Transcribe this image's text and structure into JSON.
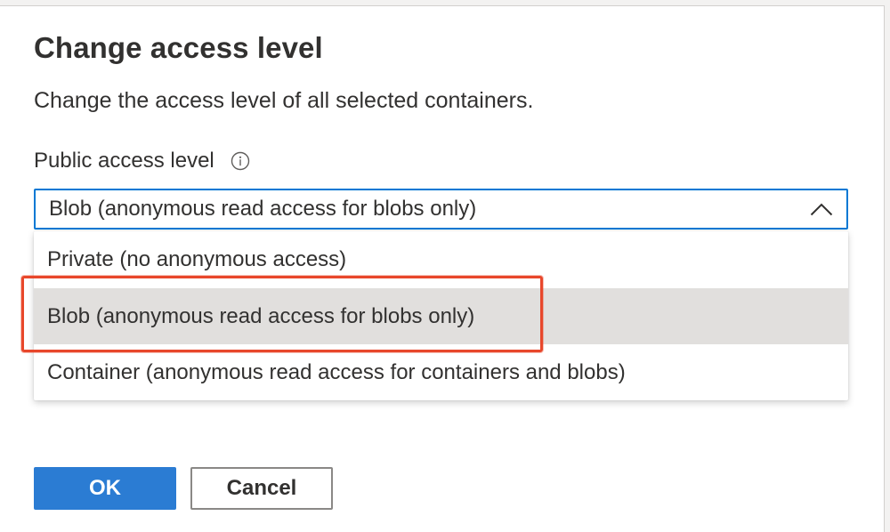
{
  "dialog": {
    "title": "Change access level",
    "description": "Change the access level of all selected containers."
  },
  "field": {
    "label": "Public access level",
    "info_icon": "info-icon",
    "selected_value": "Blob (anonymous read access for blobs only)",
    "chevron_icon": "chevron-up-icon",
    "options": [
      {
        "label": "Private (no anonymous access)",
        "selected": false
      },
      {
        "label": "Blob (anonymous read access for blobs only)",
        "selected": true
      },
      {
        "label": "Container (anonymous read access for containers and blobs)",
        "selected": false
      }
    ]
  },
  "annotation": {
    "color": "#e8472b"
  },
  "buttons": {
    "ok_label": "OK",
    "cancel_label": "Cancel"
  },
  "colors": {
    "accent": "#0078d4",
    "primary_button": "#2b7cd3",
    "selected_option_bg": "#e1dfdd"
  }
}
